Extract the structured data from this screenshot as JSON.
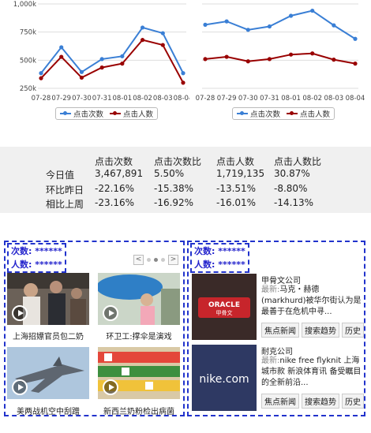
{
  "chart_data": [
    {
      "type": "line",
      "categories": [
        "07-28",
        "07-29",
        "07-30",
        "07-31",
        "08-01",
        "08-02",
        "08-03",
        "08-04"
      ],
      "yticks": [
        "250k",
        "500k",
        "750k",
        "1,000k"
      ],
      "ylim": [
        250000,
        1000000
      ],
      "series": [
        {
          "name": "点击次数",
          "color": "#3a7fd5",
          "values": [
            385000,
            615000,
            395000,
            510000,
            535000,
            790000,
            740000,
            385000
          ]
        },
        {
          "name": "点击人数",
          "color": "#990000",
          "values": [
            340000,
            530000,
            345000,
            435000,
            470000,
            680000,
            635000,
            300000
          ]
        }
      ]
    },
    {
      "type": "line",
      "categories": [
        "07-28",
        "07-29",
        "07-30",
        "07-31",
        "08-01",
        "08-02",
        "08-03",
        "08-04"
      ],
      "ylim": [
        250000,
        1000000
      ],
      "series": [
        {
          "name": "点击次数",
          "color": "#3a7fd5",
          "values": [
            815000,
            845000,
            770000,
            800000,
            895000,
            940000,
            810000,
            690000
          ]
        },
        {
          "name": "点击人数",
          "color": "#990000",
          "values": [
            510000,
            530000,
            490000,
            510000,
            550000,
            560000,
            505000,
            470000
          ]
        }
      ]
    }
  ],
  "stats": {
    "headers": [
      "点击次数",
      "点击次数比",
      "点击人数",
      "点击人数比"
    ],
    "rows": [
      {
        "label": "今日值",
        "values": [
          "3,467,891",
          "5.50%",
          "1,719,135",
          "30.87%"
        ]
      },
      {
        "label": "环比昨日",
        "values": [
          "-22.16%",
          "-15.38%",
          "-13.51%",
          "-8.80%"
        ]
      },
      {
        "label": "相比上周",
        "values": [
          "-23.16%",
          "-16.92%",
          "-16.01%",
          "-14.13%"
        ]
      }
    ]
  },
  "left_panel": {
    "counter_clicks": "次数: ******",
    "counter_users": "人数: ******",
    "pager": {
      "prev": "<",
      "next": ">"
    },
    "videos": [
      {
        "caption": "上海招嫖官员包二奶",
        "icon": "play-icon"
      },
      {
        "caption": "环卫工:撑伞是演戏",
        "icon": "play-icon"
      },
      {
        "caption": "美两战机空中刮蹭",
        "icon": "play-icon"
      },
      {
        "caption": "新西兰奶粉检出病菌",
        "icon": "play-icon"
      }
    ]
  },
  "right_panel": {
    "counter_clicks": "次数: ******",
    "counter_users": "人数: ******",
    "brands": [
      {
        "name": "甲骨文公司",
        "latest_label": "最新:",
        "latest": "马克・赫德(markhurd)被华尔街认为是最善于在危机中寻...",
        "logo_text": "ORACLE",
        "logo_sub": "甲骨文",
        "tags": [
          "焦点新闻",
          "搜索趋势",
          "历史"
        ]
      },
      {
        "name": "耐克公司",
        "latest_label": "最新:",
        "latest": "nike free flyknit 上海城市款 新浪体育讯 备受瞩目的全新前沿...",
        "logo_text": "nike.com",
        "tags": [
          "焦点新闻",
          "搜索趋势",
          "历史"
        ]
      }
    ]
  }
}
